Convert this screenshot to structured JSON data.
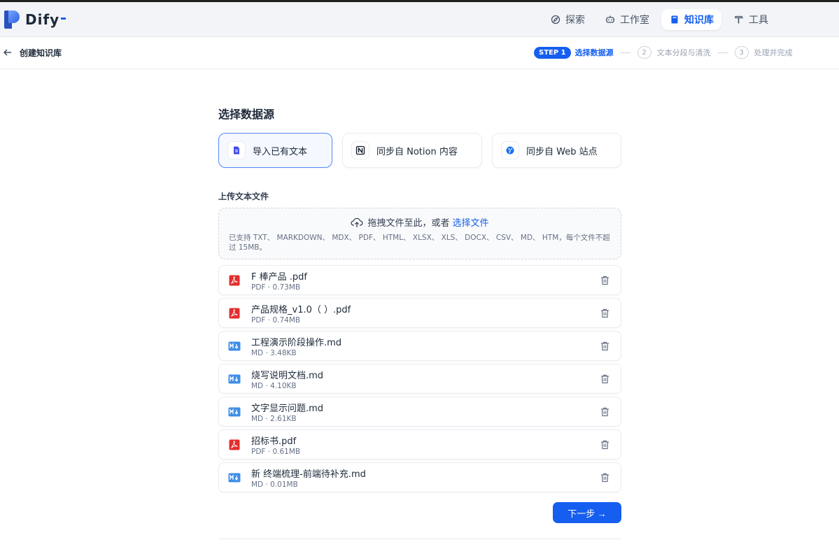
{
  "app": {
    "name": "Dify"
  },
  "nav": {
    "items": [
      {
        "label": "探索",
        "icon": "compass-icon",
        "active": false
      },
      {
        "label": "工作室",
        "icon": "robot-icon",
        "active": false
      },
      {
        "label": "知识库",
        "icon": "book-icon",
        "active": true
      },
      {
        "label": "工具",
        "icon": "hammer-icon",
        "active": false
      }
    ]
  },
  "subheader": {
    "back_label": "创建知识库",
    "steps": {
      "step1_badge": "STEP 1",
      "step1_label": "选择数据源",
      "step2_num": "2",
      "step2_label": "文本分段与清洗",
      "step3_num": "3",
      "step3_label": "处理并完成"
    }
  },
  "main": {
    "section_title": "选择数据源",
    "sources": [
      {
        "label": "导入已有文本",
        "icon": "file-text-icon",
        "active": true
      },
      {
        "label": "同步自 Notion 内容",
        "icon": "notion-icon",
        "active": false
      },
      {
        "label": "同步自 Web 站点",
        "icon": "globe-icon",
        "active": false
      }
    ],
    "upload_title": "上传文本文件",
    "dropzone": {
      "text": "拖拽文件至此，或者",
      "link": "选择文件",
      "hint": "已支持 TXT、 MARKDOWN、 MDX、 PDF、 HTML、 XLSX、 XLS、 DOCX、 CSV、 MD、 HTM，每个文件不超过 15MB。"
    },
    "files": [
      {
        "name": "F             棒产品              .pdf",
        "meta": "PDF · 0.73MB",
        "type": "pdf"
      },
      {
        "name": "                  产品规格_v1.0（         ）.pdf",
        "meta": "PDF · 0.74MB",
        "type": "pdf"
      },
      {
        "name": "工程演示阶段操作.md",
        "meta": "MD · 3.48KB",
        "type": "md"
      },
      {
        "name": "烧写说明文档.md",
        "meta": "MD · 4.10KB",
        "type": "md"
      },
      {
        "name": "      文字显示问题.md",
        "meta": "MD · 2.61KB",
        "type": "md"
      },
      {
        "name": "招标书.pdf",
        "meta": "PDF · 0.61MB",
        "type": "pdf"
      },
      {
        "name": "新                   终端梳理-前端待补充.md",
        "meta": "MD · 0.01MB",
        "type": "md"
      }
    ],
    "next_label": "下一步 →"
  },
  "colors": {
    "accent": "#155eef",
    "pdf": "#e62e2e",
    "md": "#3e8ee8"
  }
}
